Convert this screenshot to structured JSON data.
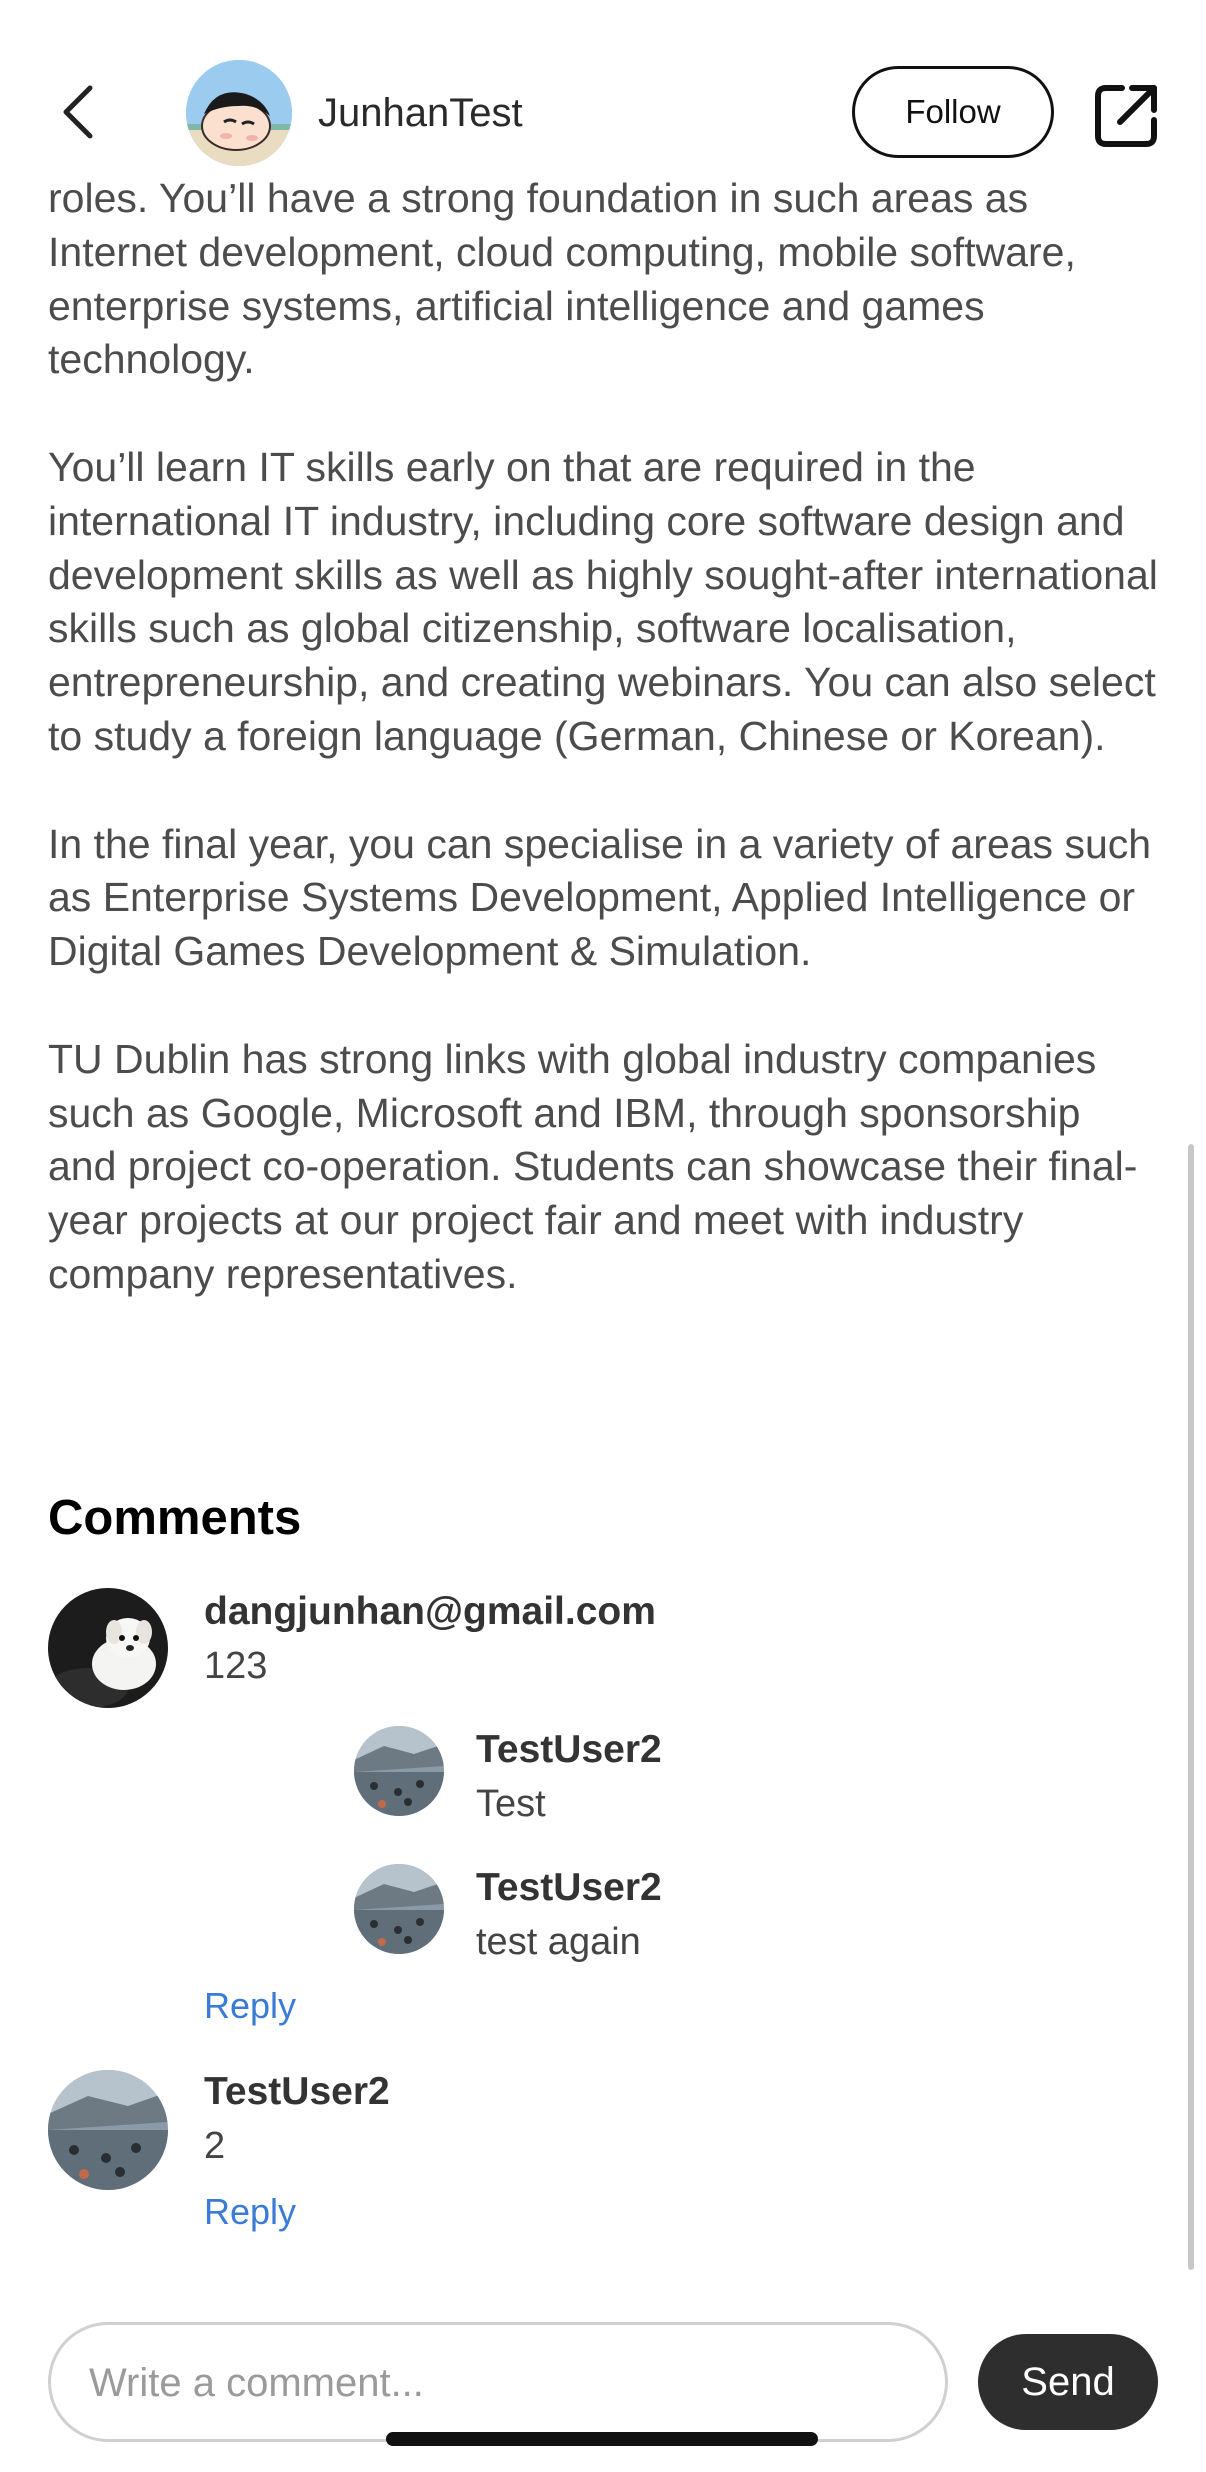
{
  "header": {
    "author_name": "JunhanTest",
    "follow_label": "Follow",
    "back_icon": "chevron-left-icon",
    "share_icon": "share-external-icon"
  },
  "article": {
    "paragraphs": [
      "roles. You’ll have a strong foundation in such areas as Internet development, cloud computing, mobile software, enterprise systems, artificial intelligence and games technology.",
      "You’ll learn IT skills early on that are required in the international IT industry, including core software design and development skills as well as highly sought-after international skills such as global citizenship, software localisation, entrepreneurship, and creating webinars. You can also select to study a foreign language (German, Chinese or Korean).",
      "In the final year, you can specialise in a variety of areas such as Enterprise Systems Development, Applied Intelligence or Digital Games Development & Simulation.",
      "TU Dublin has strong links with global industry companies such as Google, Microsoft and IBM, through sponsorship and project co-operation. Students can showcase their final-year projects at our project fair and meet with industry company representatives."
    ]
  },
  "comments": {
    "title": "Comments",
    "items": [
      {
        "author": "dangjunhan@gmail.com",
        "text": "123",
        "reply_label": "Reply",
        "replies": [
          {
            "author": "TestUser2",
            "text": "Test"
          },
          {
            "author": "TestUser2",
            "text": "test again"
          }
        ]
      },
      {
        "author": "TestUser2",
        "text": "2",
        "reply_label": "Reply",
        "replies": []
      }
    ]
  },
  "composer": {
    "placeholder": "Write a comment...",
    "value": "",
    "send_label": "Send"
  },
  "colors": {
    "link": "#3a7bd5",
    "send_button": "#2e2e2e",
    "body_text": "#4c4c4c"
  }
}
